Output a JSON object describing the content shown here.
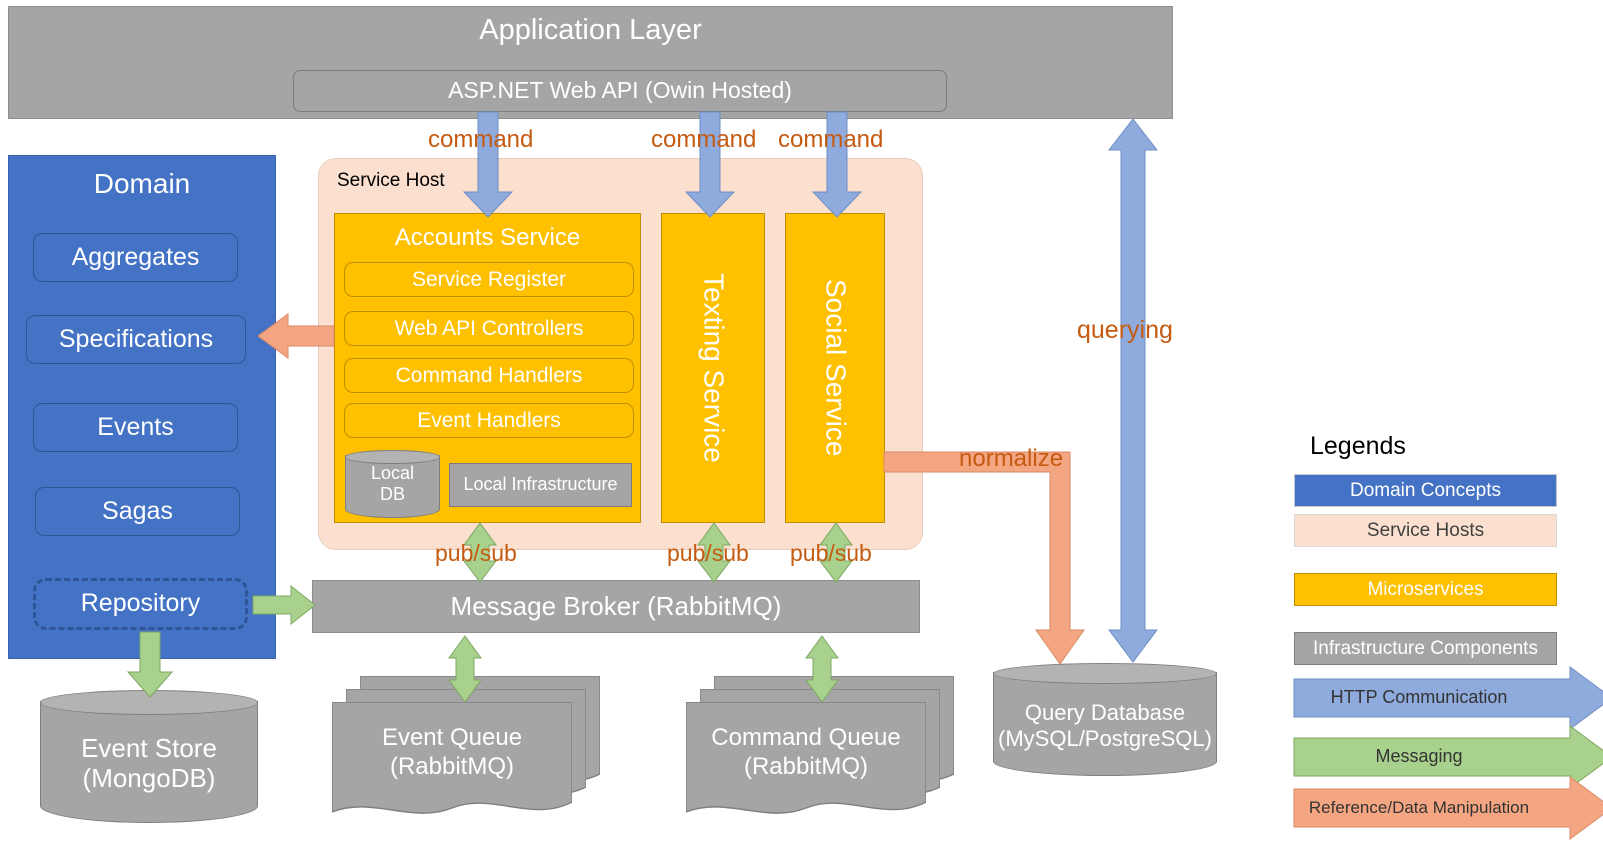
{
  "application_layer": {
    "title": "Application Layer",
    "api_box": "ASP.NET Web API (Owin Hosted)"
  },
  "domain": {
    "title": "Domain",
    "items": [
      {
        "label": "Aggregates"
      },
      {
        "label": "Specifications"
      },
      {
        "label": "Events"
      },
      {
        "label": "Sagas"
      },
      {
        "label": "Repository"
      }
    ]
  },
  "service_host": {
    "title": "Service Host",
    "accounts_service": {
      "title": "Accounts Service",
      "items": [
        {
          "label": "Service Register"
        },
        {
          "label": "Web API Controllers"
        },
        {
          "label": "Command Handlers"
        },
        {
          "label": "Event Handlers"
        }
      ],
      "local_db": "Local\nDB",
      "local_db_line1": "Local",
      "local_db_line2": "DB",
      "local_infrastructure": "Local Infrastructure"
    },
    "texting_service": "Texting Service",
    "social_service": "Social Service"
  },
  "infrastructure": {
    "message_broker": "Message Broker (RabbitMQ)",
    "event_store_line1": "Event Store",
    "event_store_line2": "(MongoDB)",
    "event_queue_line1": "Event Queue",
    "event_queue_line2": "(RabbitMQ)",
    "command_queue_line1": "Command Queue",
    "command_queue_line2": "(RabbitMQ)",
    "query_db_line1": "Query Database",
    "query_db_line2": "(MySQL/PostgreSQL)"
  },
  "edge_labels": {
    "command_1": "command",
    "command_2": "command",
    "command_3": "command",
    "querying": "querying",
    "normalize": "normalize",
    "pubsub_1": "pub/sub",
    "pubsub_2": "pub/sub",
    "pubsub_3": "pub/sub"
  },
  "legend": {
    "title": "Legends",
    "boxes": [
      {
        "label": "Domain Concepts",
        "color": "#4472C4",
        "text_color": "#ffffff"
      },
      {
        "label": "Service Hosts",
        "color": "#FBE0D0",
        "text_color": "#404040"
      },
      {
        "label": "Microservices",
        "color": "#FFC000",
        "text_color": "#ffffff"
      },
      {
        "label": "Infrastructure Components",
        "color": "#A5A5A5",
        "text_color": "#ffffff"
      }
    ],
    "arrows": [
      {
        "label": "HTTP Communication",
        "color": "#8FAADC"
      },
      {
        "label": "Messaging",
        "color": "#A9D18E"
      },
      {
        "label": "Reference/Data Manipulation",
        "color": "#F4A582"
      }
    ]
  },
  "colors": {
    "domain_blue": "#4472C4",
    "service_host_peach": "#FBE0D0",
    "microservice_amber": "#FFC000",
    "infrastructure_gray": "#A5A5A5",
    "http_blue": "#8FAADC",
    "messaging_green": "#A9D18E",
    "reference_orange": "#F4A582",
    "label_orange": "#C55A11"
  }
}
